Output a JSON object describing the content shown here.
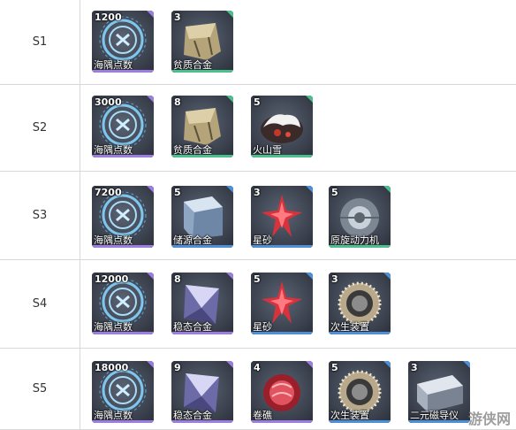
{
  "rows": [
    {
      "label": "S1",
      "items": [
        {
          "count": "1200",
          "name": "海隅点数",
          "type": "coin",
          "rarity": "#9d7ee0"
        },
        {
          "count": "3",
          "name": "贫质合金",
          "type": "ore",
          "rarity": "#4cc08c"
        }
      ]
    },
    {
      "label": "S2",
      "items": [
        {
          "count": "3000",
          "name": "海隅点数",
          "type": "coin",
          "rarity": "#9d7ee0"
        },
        {
          "count": "8",
          "name": "贫质合金",
          "type": "ore",
          "rarity": "#4cc08c"
        },
        {
          "count": "5",
          "name": "火山雪",
          "type": "snow",
          "rarity": "#4cc08c"
        }
      ]
    },
    {
      "label": "S3",
      "items": [
        {
          "count": "7200",
          "name": "海隅点数",
          "type": "coin",
          "rarity": "#9d7ee0"
        },
        {
          "count": "5",
          "name": "储源合金",
          "type": "cube",
          "rarity": "#4f8fd8"
        },
        {
          "count": "3",
          "name": "星砂",
          "type": "star",
          "rarity": "#4f8fd8"
        },
        {
          "count": "5",
          "name": "原旋动力机",
          "type": "engine",
          "rarity": "#4cc08c"
        }
      ]
    },
    {
      "label": "S4",
      "items": [
        {
          "count": "12000",
          "name": "海隅点数",
          "type": "coin",
          "rarity": "#9d7ee0"
        },
        {
          "count": "8",
          "name": "稳态合金",
          "type": "prism",
          "rarity": "#9d7ee0"
        },
        {
          "count": "5",
          "name": "星砂",
          "type": "star",
          "rarity": "#4f8fd8"
        },
        {
          "count": "3",
          "name": "次生装置",
          "type": "ring",
          "rarity": "#4f8fd8"
        }
      ]
    },
    {
      "label": "S5",
      "items": [
        {
          "count": "18000",
          "name": "海隅点数",
          "type": "coin",
          "rarity": "#9d7ee0"
        },
        {
          "count": "9",
          "name": "稳态合金",
          "type": "prism",
          "rarity": "#9d7ee0"
        },
        {
          "count": "4",
          "name": "卷礁",
          "type": "coral",
          "rarity": "#9d7ee0"
        },
        {
          "count": "5",
          "name": "次生装置",
          "type": "ring",
          "rarity": "#4f8fd8"
        },
        {
          "count": "3",
          "name": "二元磁导仪",
          "type": "metal",
          "rarity": "#4f8fd8"
        }
      ]
    }
  ],
  "watermark": "游侠网"
}
